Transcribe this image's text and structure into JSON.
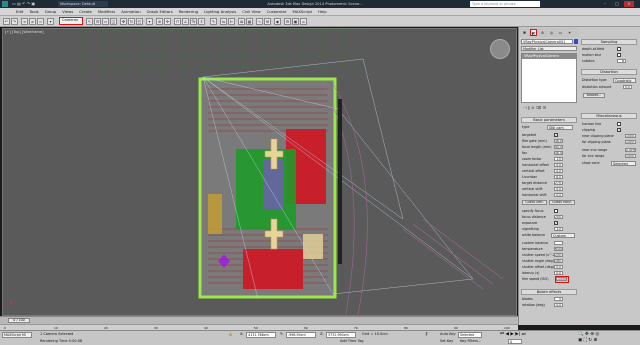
{
  "titlebar": {
    "workspace": "Workspace: Default",
    "title": "Autodesk 3ds Max Design 2014    Photometric Scene...",
    "search_placeholder": "Type a keyword or phrase"
  },
  "menu": [
    "Edit",
    "Tools",
    "Group",
    "Views",
    "Create",
    "Modifiers",
    "Animation",
    "Graph Editors",
    "Rendering",
    "Lighting Analysis",
    "Civil View",
    "Customize",
    "MAXScript",
    "Help"
  ],
  "toolbar": {
    "camera_dropdown": "Cameras"
  },
  "viewport": {
    "label": "[+] [Top] [Wireframe]"
  },
  "command_panel": {
    "object_name": "VRayPhysicalCamera001",
    "modifier_list": "Modifier List",
    "stack_item": "VRayPhysicalCamera",
    "basic_parameters": {
      "header": "Basic parameters",
      "type_label": "type",
      "type_value": "Still cam",
      "rows": [
        {
          "label": "targeted",
          "value": "✓"
        },
        {
          "label": "film gate (mm)",
          "value": "36.0"
        },
        {
          "label": "focal length (mm)",
          "value": "40.0"
        },
        {
          "label": "fov",
          "value": "48.455"
        },
        {
          "label": "zoom factor",
          "value": "1.0"
        },
        {
          "label": "horizontal offset",
          "value": "0.0"
        },
        {
          "label": "vertical offset",
          "value": "0.0"
        },
        {
          "label": "f-number",
          "value": "8.0"
        },
        {
          "label": "target distance",
          "value": "275.65"
        },
        {
          "label": "vertical shift",
          "value": "0.0"
        },
        {
          "label": "horizontal shift",
          "value": "0.0"
        }
      ],
      "guess_vert": "Guess vert.",
      "guess_horiz": "Guess horiz.",
      "rows2": [
        {
          "label": "specify focus",
          "value": ""
        },
        {
          "label": "focus distance",
          "value": "200.0"
        },
        {
          "label": "exposure",
          "value": "✓"
        },
        {
          "label": "vignetting",
          "value": "1.0"
        },
        {
          "label": "white balance",
          "value": "Custom"
        }
      ],
      "rows3": [
        {
          "label": "custom balance",
          "value": ""
        },
        {
          "label": "temperature",
          "value": "6500.0"
        },
        {
          "label": "shutter speed (s^-1)",
          "value": "200.0"
        },
        {
          "label": "shutter angle (deg)",
          "value": "180.0"
        },
        {
          "label": "shutter offset (deg)",
          "value": "0.0"
        },
        {
          "label": "latency (s)",
          "value": "0.0"
        },
        {
          "label": "film speed (ISO)",
          "value": "10000.0"
        }
      ]
    },
    "bokeh": {
      "header": "Bokeh effects",
      "rows": [
        {
          "label": "blades",
          "value": "5"
        },
        {
          "label": "rotation (deg)",
          "value": "0.0"
        }
      ]
    },
    "sampling": {
      "header": "Sampling",
      "rows": [
        {
          "label": "depth-of-field",
          "value": ""
        },
        {
          "label": "motion blur",
          "value": ""
        },
        {
          "label": "subdivs",
          "value": "6"
        }
      ]
    },
    "distortion": {
      "header": "Distortion",
      "type_label": "Distortion type",
      "type_value": "Quadratic",
      "amount_label": "distortion amount",
      "amount_value": "0.0",
      "button": "Browse..."
    },
    "misc": {
      "header": "Miscellaneous",
      "rows": [
        {
          "label": "horizon line",
          "value": ""
        },
        {
          "label": "clipping",
          "value": "✓"
        },
        {
          "label": "near clipping plane",
          "value": "1000.0"
        },
        {
          "label": "far clipping plane",
          "value": "1000.0"
        },
        {
          "label": "near env range",
          "value": "0.0cm"
        },
        {
          "label": "far env range",
          "value": "1000.0"
        },
        {
          "label": "show cone",
          "value": "Selected"
        }
      ]
    }
  },
  "timeslider": {
    "frame_label": "0 / 100",
    "ticks": [
      "0",
      "10",
      "20",
      "30",
      "40",
      "50",
      "60",
      "70",
      "80",
      "90",
      "100"
    ]
  },
  "statusbar": {
    "maxscript": "MAXScript Mi",
    "selection": "1 Camera Selected",
    "prompt": "Rendering Time  0:00:08",
    "x_label": "X:",
    "x_value": "4131.766cm",
    "y_label": "Y:",
    "y_value": "-998.94cm",
    "z_label": "Z:",
    "z_value": "3731.994cm",
    "grid": "Grid = 10.0cm",
    "add_time_tag": "Add Time Tag",
    "auto_key": "Auto Key",
    "selected": "Selected",
    "set_key": "Set Key",
    "key_filters": "Key Filters...",
    "frame": "0"
  }
}
